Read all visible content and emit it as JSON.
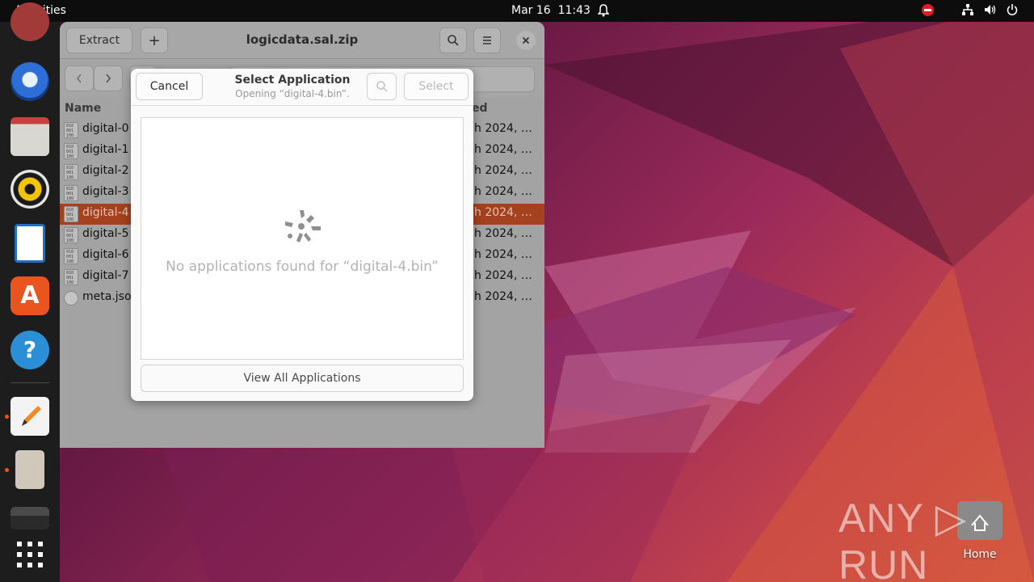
{
  "topbar": {
    "activities": "Activities",
    "date": "Mar 16",
    "time": "11:43"
  },
  "window": {
    "title": "logicdata.sal.zip",
    "extract_label": "Extract",
    "add_label": "+",
    "columns": {
      "name": "Name",
      "modified": "ed"
    },
    "rows": [
      {
        "name": "digital-0",
        "date": "h 2024, …",
        "selected": false
      },
      {
        "name": "digital-1",
        "date": "h 2024, …",
        "selected": false
      },
      {
        "name": "digital-2",
        "date": "h 2024, …",
        "selected": false
      },
      {
        "name": "digital-3",
        "date": "h 2024, …",
        "selected": false
      },
      {
        "name": "digital-4",
        "date": "h 2024, …",
        "selected": true
      },
      {
        "name": "digital-5",
        "date": "h 2024, …",
        "selected": false
      },
      {
        "name": "digital-6",
        "date": "h 2024, …",
        "selected": false
      },
      {
        "name": "digital-7",
        "date": "h 2024, …",
        "selected": false
      },
      {
        "name": "meta.jso",
        "date": "h 2024, …",
        "selected": false
      }
    ]
  },
  "dialog": {
    "cancel_label": "Cancel",
    "title": "Select Application",
    "subtitle": "Opening “digital-4.bin”.",
    "select_label": "Select",
    "empty_message": "No applications found for “digital-4.bin”",
    "view_all_label": "View All Applications"
  },
  "desktop": {
    "home_label": "Home",
    "watermark": "ANY ▷ RUN"
  },
  "colors": {
    "accent": "#e95420",
    "selection": "#a4411e",
    "dnd": "#e01b24"
  }
}
